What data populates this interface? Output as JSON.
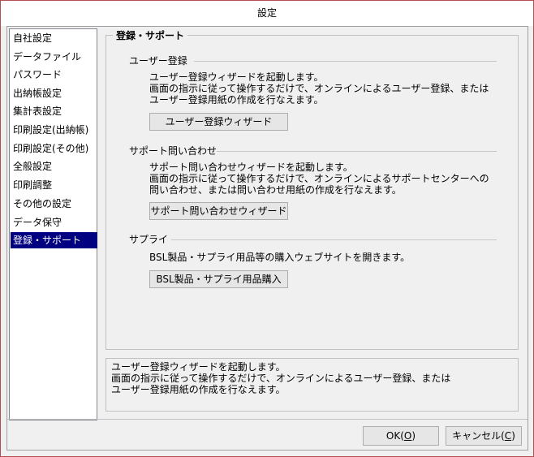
{
  "window": {
    "title": "設定"
  },
  "sidebar": {
    "items": [
      {
        "label": "自社設定"
      },
      {
        "label": "データファイル"
      },
      {
        "label": "パスワード"
      },
      {
        "label": "出納帳設定"
      },
      {
        "label": "集計表設定"
      },
      {
        "label": "印刷設定(出納帳)"
      },
      {
        "label": "印刷設定(その他)"
      },
      {
        "label": "全般設定"
      },
      {
        "label": "印刷調整"
      },
      {
        "label": "その他の設定"
      },
      {
        "label": "データ保守"
      },
      {
        "label": "登録・サポート",
        "selected": true
      }
    ]
  },
  "panel": {
    "title": "登録・サポート",
    "user_registration": {
      "heading": "ユーザー登録",
      "desc": [
        "ユーザー登録ウィザードを起動します。",
        "画面の指示に従って操作するだけで、オンラインによるユーザー登録、または",
        "ユーザー登録用紙の作成を行なえます。"
      ],
      "button": "ユーザー登録ウィザード"
    },
    "support_inquiry": {
      "heading": "サポート問い合わせ",
      "desc": [
        "サポート問い合わせウィザードを起動します。",
        "画面の指示に従って操作するだけで、オンラインによるサポートセンターへの",
        "問い合わせ、または問い合わせ用紙の作成を行なえます。"
      ],
      "button": "サポート問い合わせウィザード"
    },
    "supply": {
      "heading": "サプライ",
      "desc": [
        "BSL製品・サプライ用品等の購入ウェブサイトを開きます。"
      ],
      "button": "BSL製品・サプライ用品購入"
    }
  },
  "status": {
    "lines": [
      "ユーザー登録ウィザードを起動します。",
      "画面の指示に従って操作するだけで、オンラインによるユーザー登録、または",
      "ユーザー登録用紙の作成を行なえます。"
    ]
  },
  "footer": {
    "ok_label": "OK(",
    "ok_accel": "O",
    "ok_close": ")",
    "cancel_label": "キャンセル(",
    "cancel_accel": "C",
    "cancel_close": ")"
  }
}
